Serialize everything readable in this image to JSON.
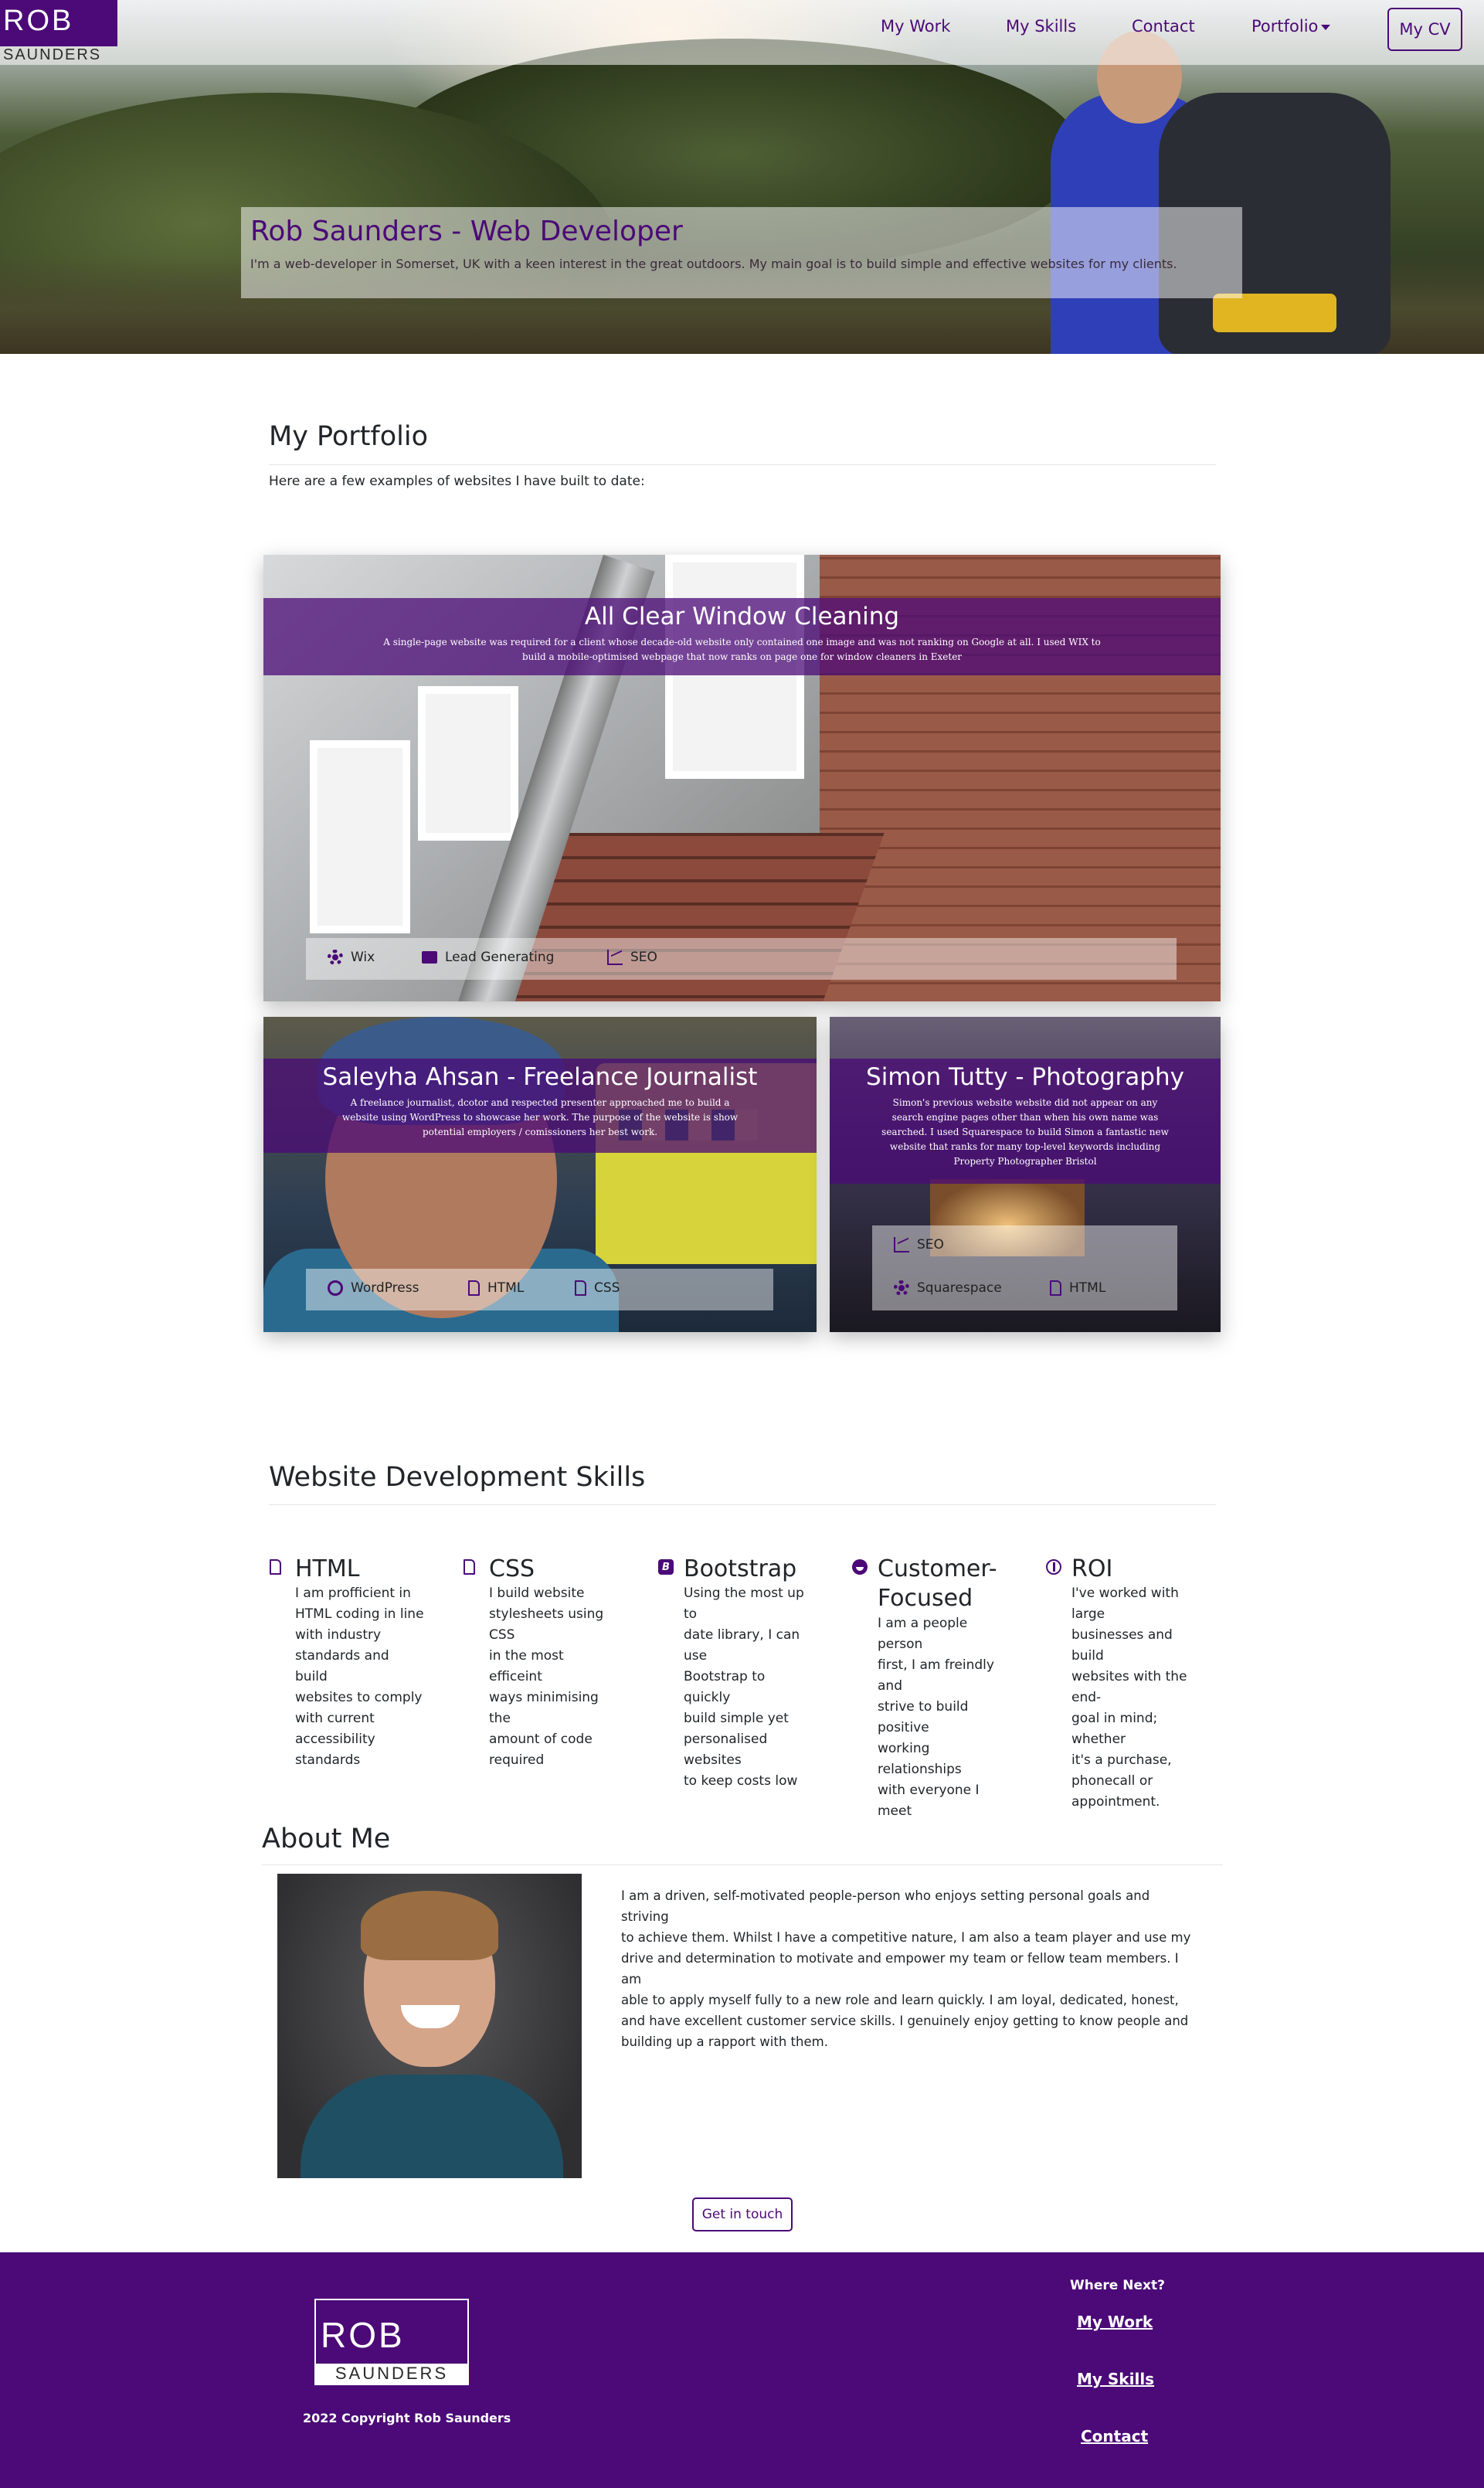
{
  "brand": {
    "logo_top": "ROB",
    "logo_bottom": "SAUNDERS"
  },
  "nav": {
    "items": [
      "My Work",
      "My Skills",
      "Contact",
      "Portfolio"
    ],
    "cv_button": "My CV"
  },
  "hero": {
    "title": "Rob Saunders - Web Developer",
    "subtitle": "I'm a web-developer in Somerset, UK with a keen interest in the great outdoors. My main goal is to build simple and effective websites for my clients."
  },
  "portfolio": {
    "title": "My Portfolio",
    "intro": "Here are a few examples of websites I have built to date:",
    "cards": [
      {
        "title": "All Clear Window Cleaning",
        "text": "A single-page website was required for a client whose decade-old website only contained one image and was not ranking on Google at all. I used WIX to build a mobile-optimised webpage that now ranks on page one for window cleaners in Exeter",
        "tags": [
          {
            "label": "Wix",
            "icon": "gear-icon"
          },
          {
            "label": "Lead Generating",
            "icon": "envelope-icon"
          },
          {
            "label": "SEO",
            "icon": "chart-icon"
          }
        ]
      },
      {
        "title": "Saleyha Ahsan - Freelance Journalist",
        "text": "A freelance journalist, dcotor and respected presenter approached me to build a website using WordPress to showcase her work. The purpose of the website is show potential employers / comissioners her best work.",
        "tags": [
          {
            "label": "WordPress",
            "icon": "wordpress-icon"
          },
          {
            "label": "HTML",
            "icon": "file-icon"
          },
          {
            "label": "CSS",
            "icon": "file-icon"
          }
        ]
      },
      {
        "title": "Simon Tutty - Photography",
        "text": "Simon's previous website website did not appear on any search engine pages other than when his own name was searched. I used Squarespace to build Simon a fantastic new website that ranks for many top-level keywords including Property Photographer Bristol",
        "tags": [
          {
            "label": "SEO",
            "icon": "chart-icon"
          },
          {
            "label": "Squarespace",
            "icon": "gear-icon"
          },
          {
            "label": "HTML",
            "icon": "file-icon"
          }
        ]
      }
    ]
  },
  "skills": {
    "title": "Website Development Skills",
    "items": [
      {
        "title": "HTML",
        "icon": "file-icon",
        "lines": [
          "I am profficient in",
          "HTML coding in line",
          "with industry",
          "standards and build",
          "websites to comply",
          "with current",
          "accessibility standards"
        ]
      },
      {
        "title": "CSS",
        "icon": "file-icon",
        "lines": [
          "I build website",
          "stylesheets using CSS",
          "in the most efficeint",
          "ways minimising the",
          "amount of code",
          "required"
        ]
      },
      {
        "title": "Bootstrap",
        "icon": "bootstrap-icon",
        "lines": [
          "Using the most up to",
          "date library, I can use",
          "Bootstrap to quickly",
          "build simple yet",
          "personalised websites",
          "to keep costs low"
        ]
      },
      {
        "title_lines": [
          "Customer-",
          "Focused"
        ],
        "icon": "smile-icon",
        "lines": [
          "I am a people person",
          "first, I am freindly and",
          "strive to build positive",
          "working relationships",
          "with everyone I meet"
        ]
      },
      {
        "title": "ROI",
        "icon": "roi-icon",
        "lines": [
          "I've worked with large",
          "businesses and build",
          "websites with the end-",
          "goal in mind; whether",
          "it's a purchase,",
          "phonecall or",
          "appointment."
        ]
      }
    ]
  },
  "about": {
    "title": "About Me",
    "lines": [
      "I am a driven, self-motivated people-person who enjoys setting personal goals and striving",
      "to achieve them. Whilst I have a competitive nature, I am also a team player and use my",
      "drive and determination to motivate and empower my team or fellow team members. I am",
      "able to apply myself fully to a new role and learn quickly. I am loyal, dedicated, honest,",
      "and have excellent customer service skills. I genuinely enjoy getting to know people and",
      "building up a rapport with them."
    ],
    "button": "Get in touch"
  },
  "footer": {
    "copyright": "2022 Copyright Rob Saunders",
    "heading": "Where Next?",
    "links": [
      "My Work",
      "My Skills",
      "Contact"
    ]
  },
  "colors": {
    "brand": "#4b0a77",
    "band": "rgba(75,10,119,0.75)"
  }
}
